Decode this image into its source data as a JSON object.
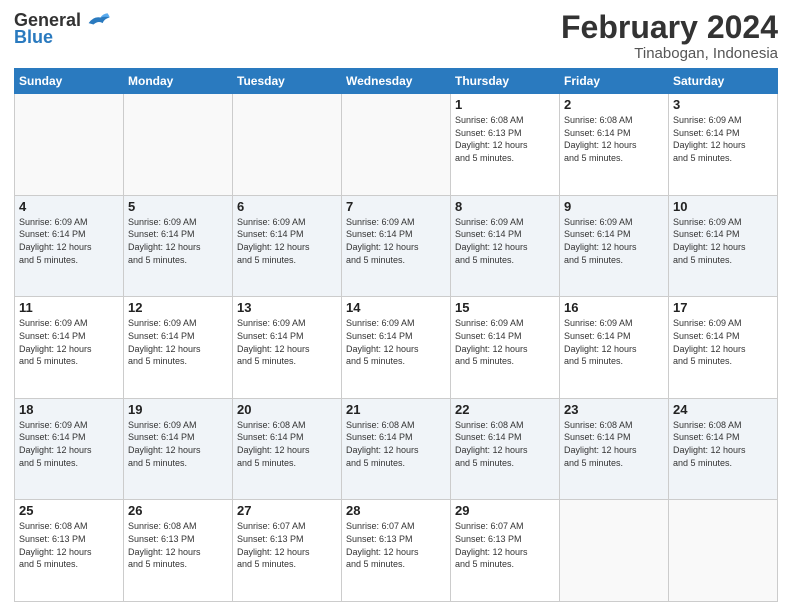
{
  "logo": {
    "text_general": "General",
    "text_blue": "Blue"
  },
  "header": {
    "title": "February 2024",
    "subtitle": "Tinabogan, Indonesia"
  },
  "weekdays": [
    "Sunday",
    "Monday",
    "Tuesday",
    "Wednesday",
    "Thursday",
    "Friday",
    "Saturday"
  ],
  "weeks": [
    [
      {
        "day": "",
        "info": ""
      },
      {
        "day": "",
        "info": ""
      },
      {
        "day": "",
        "info": ""
      },
      {
        "day": "",
        "info": ""
      },
      {
        "day": "1",
        "info": "Sunrise: 6:08 AM\nSunset: 6:13 PM\nDaylight: 12 hours\nand 5 minutes."
      },
      {
        "day": "2",
        "info": "Sunrise: 6:08 AM\nSunset: 6:14 PM\nDaylight: 12 hours\nand 5 minutes."
      },
      {
        "day": "3",
        "info": "Sunrise: 6:09 AM\nSunset: 6:14 PM\nDaylight: 12 hours\nand 5 minutes."
      }
    ],
    [
      {
        "day": "4",
        "info": "Sunrise: 6:09 AM\nSunset: 6:14 PM\nDaylight: 12 hours\nand 5 minutes."
      },
      {
        "day": "5",
        "info": "Sunrise: 6:09 AM\nSunset: 6:14 PM\nDaylight: 12 hours\nand 5 minutes."
      },
      {
        "day": "6",
        "info": "Sunrise: 6:09 AM\nSunset: 6:14 PM\nDaylight: 12 hours\nand 5 minutes."
      },
      {
        "day": "7",
        "info": "Sunrise: 6:09 AM\nSunset: 6:14 PM\nDaylight: 12 hours\nand 5 minutes."
      },
      {
        "day": "8",
        "info": "Sunrise: 6:09 AM\nSunset: 6:14 PM\nDaylight: 12 hours\nand 5 minutes."
      },
      {
        "day": "9",
        "info": "Sunrise: 6:09 AM\nSunset: 6:14 PM\nDaylight: 12 hours\nand 5 minutes."
      },
      {
        "day": "10",
        "info": "Sunrise: 6:09 AM\nSunset: 6:14 PM\nDaylight: 12 hours\nand 5 minutes."
      }
    ],
    [
      {
        "day": "11",
        "info": "Sunrise: 6:09 AM\nSunset: 6:14 PM\nDaylight: 12 hours\nand 5 minutes."
      },
      {
        "day": "12",
        "info": "Sunrise: 6:09 AM\nSunset: 6:14 PM\nDaylight: 12 hours\nand 5 minutes."
      },
      {
        "day": "13",
        "info": "Sunrise: 6:09 AM\nSunset: 6:14 PM\nDaylight: 12 hours\nand 5 minutes."
      },
      {
        "day": "14",
        "info": "Sunrise: 6:09 AM\nSunset: 6:14 PM\nDaylight: 12 hours\nand 5 minutes."
      },
      {
        "day": "15",
        "info": "Sunrise: 6:09 AM\nSunset: 6:14 PM\nDaylight: 12 hours\nand 5 minutes."
      },
      {
        "day": "16",
        "info": "Sunrise: 6:09 AM\nSunset: 6:14 PM\nDaylight: 12 hours\nand 5 minutes."
      },
      {
        "day": "17",
        "info": "Sunrise: 6:09 AM\nSunset: 6:14 PM\nDaylight: 12 hours\nand 5 minutes."
      }
    ],
    [
      {
        "day": "18",
        "info": "Sunrise: 6:09 AM\nSunset: 6:14 PM\nDaylight: 12 hours\nand 5 minutes."
      },
      {
        "day": "19",
        "info": "Sunrise: 6:09 AM\nSunset: 6:14 PM\nDaylight: 12 hours\nand 5 minutes."
      },
      {
        "day": "20",
        "info": "Sunrise: 6:08 AM\nSunset: 6:14 PM\nDaylight: 12 hours\nand 5 minutes."
      },
      {
        "day": "21",
        "info": "Sunrise: 6:08 AM\nSunset: 6:14 PM\nDaylight: 12 hours\nand 5 minutes."
      },
      {
        "day": "22",
        "info": "Sunrise: 6:08 AM\nSunset: 6:14 PM\nDaylight: 12 hours\nand 5 minutes."
      },
      {
        "day": "23",
        "info": "Sunrise: 6:08 AM\nSunset: 6:14 PM\nDaylight: 12 hours\nand 5 minutes."
      },
      {
        "day": "24",
        "info": "Sunrise: 6:08 AM\nSunset: 6:14 PM\nDaylight: 12 hours\nand 5 minutes."
      }
    ],
    [
      {
        "day": "25",
        "info": "Sunrise: 6:08 AM\nSunset: 6:13 PM\nDaylight: 12 hours\nand 5 minutes."
      },
      {
        "day": "26",
        "info": "Sunrise: 6:08 AM\nSunset: 6:13 PM\nDaylight: 12 hours\nand 5 minutes."
      },
      {
        "day": "27",
        "info": "Sunrise: 6:07 AM\nSunset: 6:13 PM\nDaylight: 12 hours\nand 5 minutes."
      },
      {
        "day": "28",
        "info": "Sunrise: 6:07 AM\nSunset: 6:13 PM\nDaylight: 12 hours\nand 5 minutes."
      },
      {
        "day": "29",
        "info": "Sunrise: 6:07 AM\nSunset: 6:13 PM\nDaylight: 12 hours\nand 5 minutes."
      },
      {
        "day": "",
        "info": ""
      },
      {
        "day": "",
        "info": ""
      }
    ]
  ]
}
